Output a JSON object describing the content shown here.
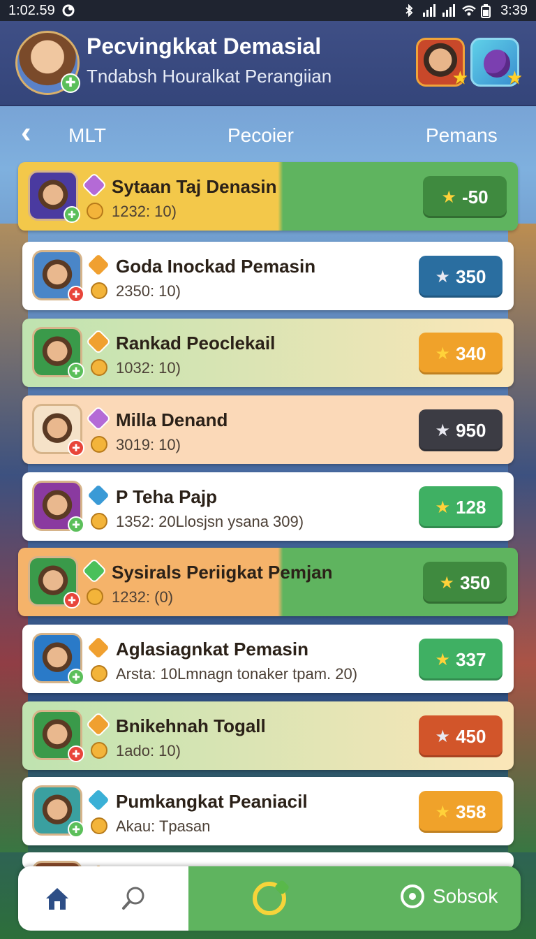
{
  "status_bar": {
    "time_left": "1:02.59",
    "time_right": "3:39"
  },
  "header": {
    "title": "Pecvingkkat Demasial",
    "subtitle": "Tndabsh Houralkat Perangiian"
  },
  "nav": {
    "tabs": [
      "MLT",
      "Pecoier",
      "Pemans"
    ]
  },
  "rows": [
    {
      "name": "Sytaan Taj Denasin",
      "stat": "1232: 10)",
      "score": "-50",
      "score_color": "#3f8a3f",
      "bg": "#f3c84a",
      "bg2": "#5fb45f",
      "highlight": true,
      "rank_color": "#b46ad6",
      "avatar_color": "#4a3aa0"
    },
    {
      "name": "Goda Inockad Pemasin",
      "stat": "2350: 10)",
      "score": "350",
      "score_color": "#2a6ea0",
      "bg": "#ffffff",
      "bg2": "#ffffff",
      "highlight": false,
      "rank_color": "#f0a030",
      "avatar_color": "#4a86c8"
    },
    {
      "name": "Rankad Peoclekail",
      "stat": "1032: 10)",
      "score": "340",
      "score_color": "#f0a22a",
      "bg": "#bfe3b0",
      "bg2": "#fbe6b8",
      "highlight": false,
      "rank_color": "#f0a030",
      "avatar_color": "#3a9a4a"
    },
    {
      "name": "Milla Denand",
      "stat": "3019: 10)",
      "score": "950",
      "score_color": "#3c3c44",
      "bg": "#fbd9b8",
      "bg2": "#fbd9b8",
      "highlight": false,
      "rank_color": "#b46ad6",
      "avatar_color": "#f5e2c8"
    },
    {
      "name": "P Teha Pajp",
      "stat": "1352: 20Llosjsn ysana 309)",
      "score": "128",
      "score_color": "#3fb063",
      "bg": "#ffffff",
      "bg2": "#ffffff",
      "highlight": false,
      "rank_color": "#3a9ad6",
      "avatar_color": "#8a3aa0"
    },
    {
      "name": "Sysirals Periigkat Pemjan",
      "stat": "1232: (0)",
      "score": "350",
      "score_color": "#3f8a3f",
      "bg": "#f5b36a",
      "bg2": "#5fb45f",
      "highlight": true,
      "rank_color": "#4ac05a",
      "avatar_color": "#3a9a4a"
    },
    {
      "name": "Aglasiagnkat Pemasin",
      "stat": "Arsta: 10Lmnagn tonaker tpam. 20)",
      "score": "337",
      "score_color": "#3fb063",
      "bg": "#ffffff",
      "bg2": "#ffffff",
      "highlight": false,
      "rank_color": "#f0a030",
      "avatar_color": "#2a7ac8"
    },
    {
      "name": "Bnikehnah Togall",
      "stat": "1ado: 10)",
      "score": "450",
      "score_color": "#d2552a",
      "bg": "#bfe3b0",
      "bg2": "#fbe6b8",
      "highlight": false,
      "rank_color": "#f0a030",
      "avatar_color": "#3a9a4a"
    },
    {
      "name": "Pumkangkat Peaniacil",
      "stat": "Akau: Tpasan",
      "score": "358",
      "score_color": "#f0a22a",
      "bg": "#ffffff",
      "bg2": "#ffffff",
      "highlight": false,
      "rank_color": "#3ab0d6",
      "avatar_color": "#3aa0a0"
    },
    {
      "name": "",
      "stat": "",
      "score": "",
      "score_color": "#2a6ea0",
      "bg": "#ffffff",
      "bg2": "#ffffff",
      "highlight": false,
      "rank_color": "#f0a030",
      "avatar_color": "#8a4a2a"
    }
  ],
  "bottom_nav": {
    "sobsok_label": "Sobsok"
  },
  "icons": {
    "back": "chevron-left-icon",
    "home": "home-icon",
    "search": "search-icon",
    "center": "refresh-icon",
    "chat": "chat-icon",
    "star": "star-icon"
  }
}
